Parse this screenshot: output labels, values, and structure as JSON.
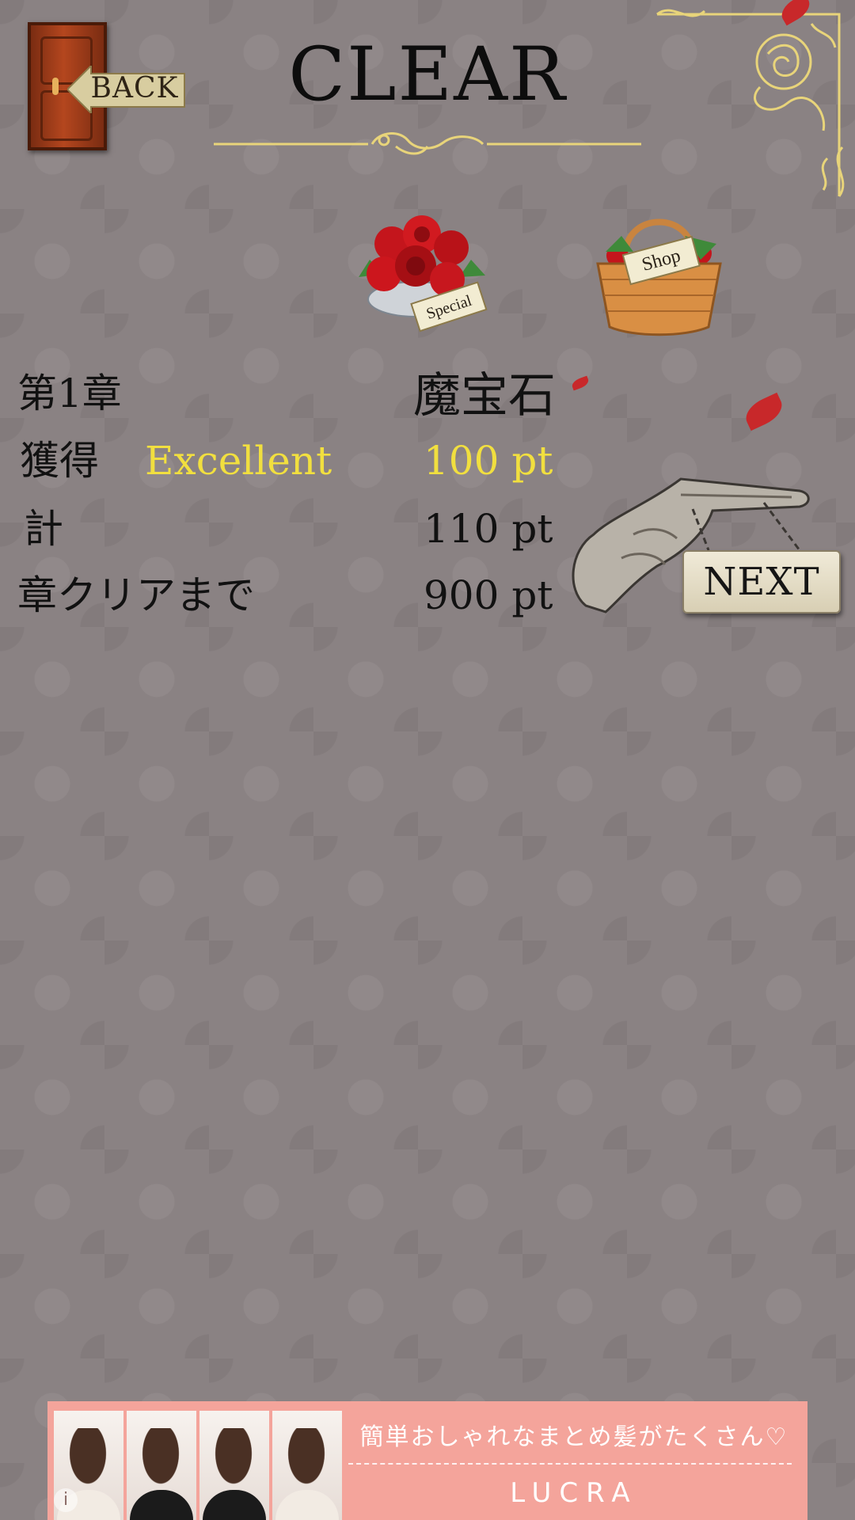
{
  "header": {
    "back_label": "BACK",
    "title": "CLEAR"
  },
  "actions": {
    "special_label": "Special",
    "shop_label": "Shop",
    "next_label": "NEXT"
  },
  "result": {
    "chapter": "第1章",
    "item": "魔宝石",
    "earned_label": "獲得",
    "rating": "Excellent",
    "earned_points": "100 pt",
    "total_label": "計",
    "total_points": "110 pt",
    "until_clear_label": "章クリアまで",
    "until_clear_points": "900 pt"
  },
  "ad": {
    "headline": "簡単おしゃれなまとめ髪がたくさん♡",
    "brand": "LUCRA",
    "info_icon": "i"
  },
  "colors": {
    "background": "#8a8283",
    "highlight": "#f1df3f",
    "gold_ornament": "#e8d47a",
    "ad_background": "#f4a49b"
  }
}
